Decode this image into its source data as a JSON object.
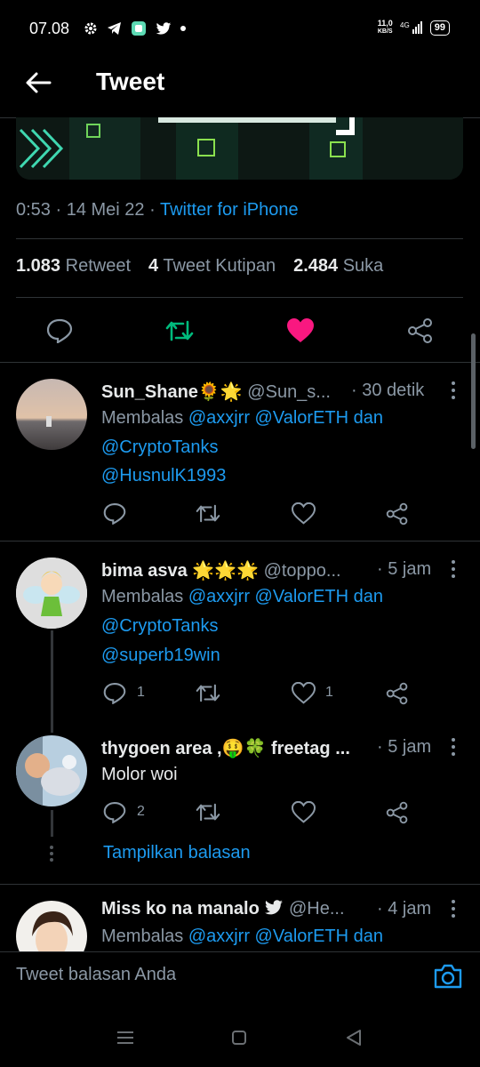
{
  "status_bar": {
    "time": "07.08",
    "net_speed_value": "11,0",
    "net_speed_unit": "KB/S",
    "network": "4G",
    "battery": "99"
  },
  "header": {
    "title": "Tweet"
  },
  "tweet": {
    "time": "0:53",
    "date": "14 Mei 22",
    "source": "Twitter for iPhone",
    "stats": {
      "retweets": "1.083",
      "retweets_label": "Retweet",
      "quotes": "4",
      "quotes_label": "Tweet Kutipan",
      "likes": "2.484",
      "likes_label": "Suka"
    }
  },
  "colors": {
    "retweet": "#00ba7c",
    "like": "#f91880",
    "link": "#1d9bf0"
  },
  "replies": [
    {
      "name": "Sun_Shane🌻🌟",
      "handle": "@Sun_s...",
      "time": "· 30 detik",
      "prefix": "Membalas ",
      "mentions": "@axxjrr @ValorETH",
      "and": " dan",
      "mention2": "@CryptoTanks",
      "extra": "@HusnulK1993"
    },
    {
      "name": "bima asva 🌟🌟🌟",
      "handle": "@toppo...",
      "time": "· 5 jam",
      "prefix": "Membalas ",
      "mentions": "@axxjrr @ValorETH",
      "and": " dan",
      "mention2": "@CryptoTanks",
      "extra": "@superb19win",
      "reply_count": "1",
      "like_count": "1"
    },
    {
      "name": "thygoen area ,🤑🍀 freetag ...",
      "time": "· 5 jam",
      "text": "Molor woi",
      "reply_count": "2"
    },
    {
      "name": "Miss ko na manalo",
      "handle": "@He...",
      "time": "· 4 jam",
      "prefix": "Membalas ",
      "mentions": "@axxjrr @ValorETH",
      "and": " dan"
    }
  ],
  "show_replies": "Tampilkan balasan",
  "composer": {
    "placeholder": "Tweet balasan Anda"
  }
}
